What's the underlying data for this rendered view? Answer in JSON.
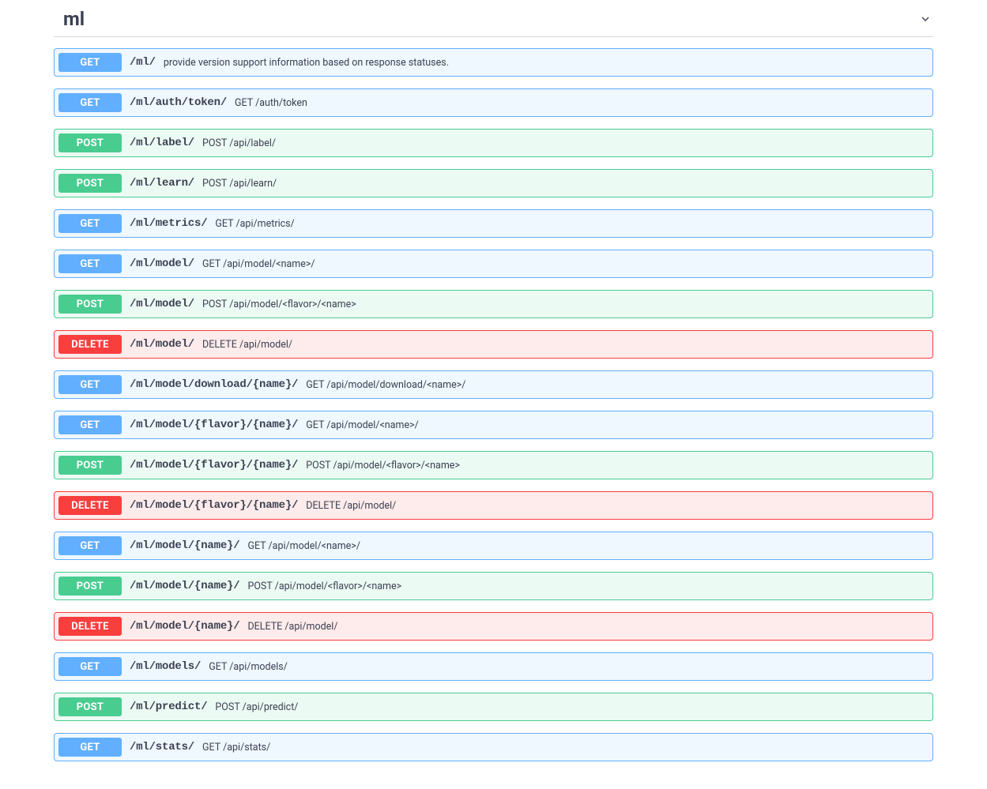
{
  "section": {
    "title": "ml"
  },
  "operations": [
    {
      "method": "GET",
      "path": "/ml/",
      "description": "provide version support information based on response statuses."
    },
    {
      "method": "GET",
      "path": "/ml/auth/token/",
      "description": "GET /auth/token"
    },
    {
      "method": "POST",
      "path": "/ml/label/",
      "description": "POST /api/label/"
    },
    {
      "method": "POST",
      "path": "/ml/learn/",
      "description": "POST /api/learn/"
    },
    {
      "method": "GET",
      "path": "/ml/metrics/",
      "description": "GET /api/metrics/"
    },
    {
      "method": "GET",
      "path": "/ml/model/",
      "description": "GET /api/model/<name>/"
    },
    {
      "method": "POST",
      "path": "/ml/model/",
      "description": "POST /api/model/<flavor>/<name>"
    },
    {
      "method": "DELETE",
      "path": "/ml/model/",
      "description": "DELETE /api/model/"
    },
    {
      "method": "GET",
      "path": "/ml/model/download/{name}/",
      "description": "GET /api/model/download/<name>/"
    },
    {
      "method": "GET",
      "path": "/ml/model/{flavor}/{name}/",
      "description": "GET /api/model/<name>/"
    },
    {
      "method": "POST",
      "path": "/ml/model/{flavor}/{name}/",
      "description": "POST /api/model/<flavor>/<name>"
    },
    {
      "method": "DELETE",
      "path": "/ml/model/{flavor}/{name}/",
      "description": "DELETE /api/model/"
    },
    {
      "method": "GET",
      "path": "/ml/model/{name}/",
      "description": "GET /api/model/<name>/"
    },
    {
      "method": "POST",
      "path": "/ml/model/{name}/",
      "description": "POST /api/model/<flavor>/<name>"
    },
    {
      "method": "DELETE",
      "path": "/ml/model/{name}/",
      "description": "DELETE /api/model/"
    },
    {
      "method": "GET",
      "path": "/ml/models/",
      "description": "GET /api/models/"
    },
    {
      "method": "POST",
      "path": "/ml/predict/",
      "description": "POST /api/predict/"
    },
    {
      "method": "GET",
      "path": "/ml/stats/",
      "description": "GET /api/stats/"
    }
  ]
}
